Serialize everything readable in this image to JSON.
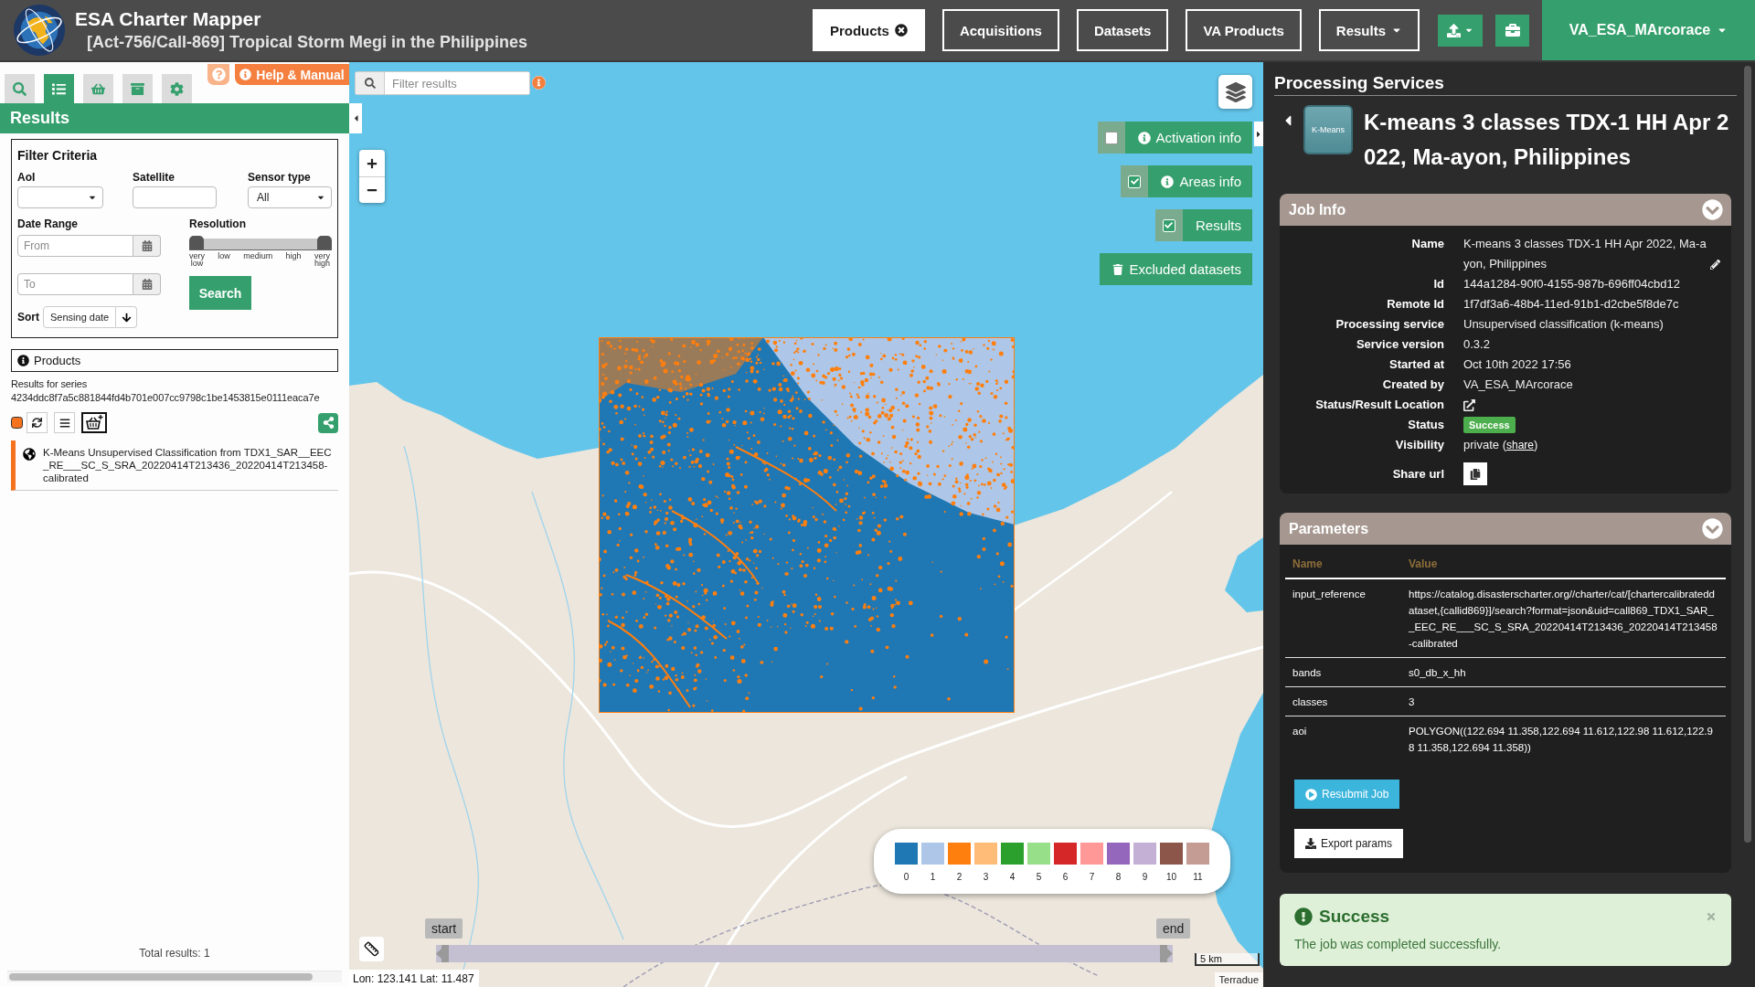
{
  "header": {
    "title": "ESA Charter Mapper",
    "subtitle": "[Act-756/Call-869] Tropical Storm Megi in the Philippines",
    "nav": [
      {
        "label": "Products",
        "selected": true,
        "kind": "closable"
      },
      {
        "label": "Acquisitions",
        "selected": false,
        "kind": "plain"
      },
      {
        "label": "Datasets",
        "selected": false,
        "kind": "plain"
      },
      {
        "label": "VA Products",
        "selected": false,
        "kind": "plain"
      },
      {
        "label": "Results",
        "selected": false,
        "kind": "dropdown"
      }
    ],
    "user": "VA_ESA_MArcorace"
  },
  "sidebar": {
    "tabs": [
      {
        "selected": false
      },
      {
        "selected": true
      },
      {
        "selected": false
      },
      {
        "selected": false
      },
      {
        "selected": false
      }
    ],
    "help": "Help & Manual",
    "title": "Results",
    "filter": {
      "title": "Filter Criteria",
      "aoi": {
        "label": "AoI"
      },
      "satellite": {
        "label": "Satellite"
      },
      "sensor_type": {
        "label": "Sensor type",
        "value": "All"
      },
      "date_range": {
        "label": "Date Range",
        "from": {
          "placeholder": "From"
        },
        "to": {
          "placeholder": "To"
        }
      },
      "resolution": {
        "label": "Resolution",
        "thumbs": [
          {
            "level": 0
          },
          {
            "level": 1
          }
        ],
        "ticks": [
          "very low",
          "low",
          "medium",
          "high",
          "very high"
        ]
      },
      "search": "Search",
      "sort": {
        "label": "Sort",
        "value": "Sensing date"
      }
    },
    "products": {
      "title": "Products",
      "series": "Results for series 4234ddc8f7a5c881844fd4b701e007cc9798c1be1453815e0111eaca7e",
      "items": [
        {
          "title": "K-Means Unsupervised Classification from TDX1_SAR__EEC_RE___SC_S_SRA_20220414T213436_20220414T213458-calibrated",
          "selected": true
        }
      ],
      "total": "Total results: 1"
    }
  },
  "map": {
    "search": {
      "placeholder": "Filter results"
    },
    "layers": [
      {
        "label": "Activation info",
        "checked": false,
        "kind": "info"
      },
      {
        "label": "Areas info",
        "checked": true,
        "kind": "info"
      },
      {
        "label": "Results",
        "checked": true,
        "kind": "plain"
      }
    ],
    "excluded": "Excluded datasets",
    "legend": [
      {
        "label": "0",
        "color": "#1f77b4"
      },
      {
        "label": "1",
        "color": "#aec7e8"
      },
      {
        "label": "2",
        "color": "#ff7f0e"
      },
      {
        "label": "3",
        "color": "#ffbb78"
      },
      {
        "label": "4",
        "color": "#2ca02c"
      },
      {
        "label": "5",
        "color": "#98df8a"
      },
      {
        "label": "6",
        "color": "#d62728"
      },
      {
        "label": "7",
        "color": "#ff9896"
      },
      {
        "label": "8",
        "color": "#9467bd"
      },
      {
        "label": "9",
        "color": "#c5b0d5"
      },
      {
        "label": "10",
        "color": "#8c564b"
      },
      {
        "label": "11",
        "color": "#c49c94"
      }
    ],
    "timeline": {
      "start": "start",
      "end": "end"
    },
    "scale": "5 km",
    "attribution": "Terradue",
    "coordinates": "Lon: 123.141 Lat: 11.487"
  },
  "details": {
    "section_title": "Processing Services",
    "service_logo": "K-Means",
    "job_title": "K-means 3 classes TDX-1 HH Apr 2022, Ma-ayon, Philippines",
    "job_info": {
      "title": "Job Info",
      "rows": [
        {
          "label": "Name",
          "kind": "editable",
          "value": "K-means 3 classes TDX-1 HH Apr 2022, Ma-ayon, Philippines"
        },
        {
          "label": "Id",
          "kind": "text",
          "value": "144a1284-90f0-4155-987b-696ff04cbd12"
        },
        {
          "label": "Remote Id",
          "kind": "text",
          "value": "1f7df3a6-48b4-11ed-91b1-d2cbe5f8de7c"
        },
        {
          "label": "Processing service",
          "kind": "text",
          "value": "Unsupervised classification (k-means)"
        },
        {
          "label": "Service version",
          "kind": "text",
          "value": "0.3.2"
        },
        {
          "label": "Started at",
          "kind": "text",
          "value": "Oct 10th 2022 17:56"
        },
        {
          "label": "Created by",
          "kind": "text",
          "value": "VA_ESA_MArcorace"
        },
        {
          "label": "Status/Result Location",
          "kind": "link"
        },
        {
          "label": "Status",
          "kind": "badge",
          "value": "Success"
        },
        {
          "label": "Visibility",
          "kind": "share",
          "value": "private (",
          "link": "share",
          "value_end": ")"
        },
        {
          "label": "Share url",
          "kind": "copy"
        }
      ]
    },
    "parameters": {
      "title": "Parameters",
      "columns": [
        "Name",
        "Value"
      ],
      "rows": [
        {
          "name": "input_reference",
          "value": "https://catalog.disasterscharter.org//charter/cat/[chartercalibrateddataset,{callid869}]/search?format=json&uid=call869_TDX1_SAR__EEC_RE___SC_S_SRA_20220414T213436_20220414T213458-calibrated"
        },
        {
          "name": "bands",
          "value": "s0_db_x_hh"
        },
        {
          "name": "classes",
          "value": "3"
        },
        {
          "name": "aoi",
          "value": "POLYGON((122.694 11.358,122.694 11.612,122.98 11.612,122.98 11.358,122.694 11.358))"
        }
      ],
      "resubmit": "Resubmit Job",
      "export": "Export params"
    },
    "alert": {
      "title": "Success",
      "message": "The job was completed successfully."
    }
  }
}
